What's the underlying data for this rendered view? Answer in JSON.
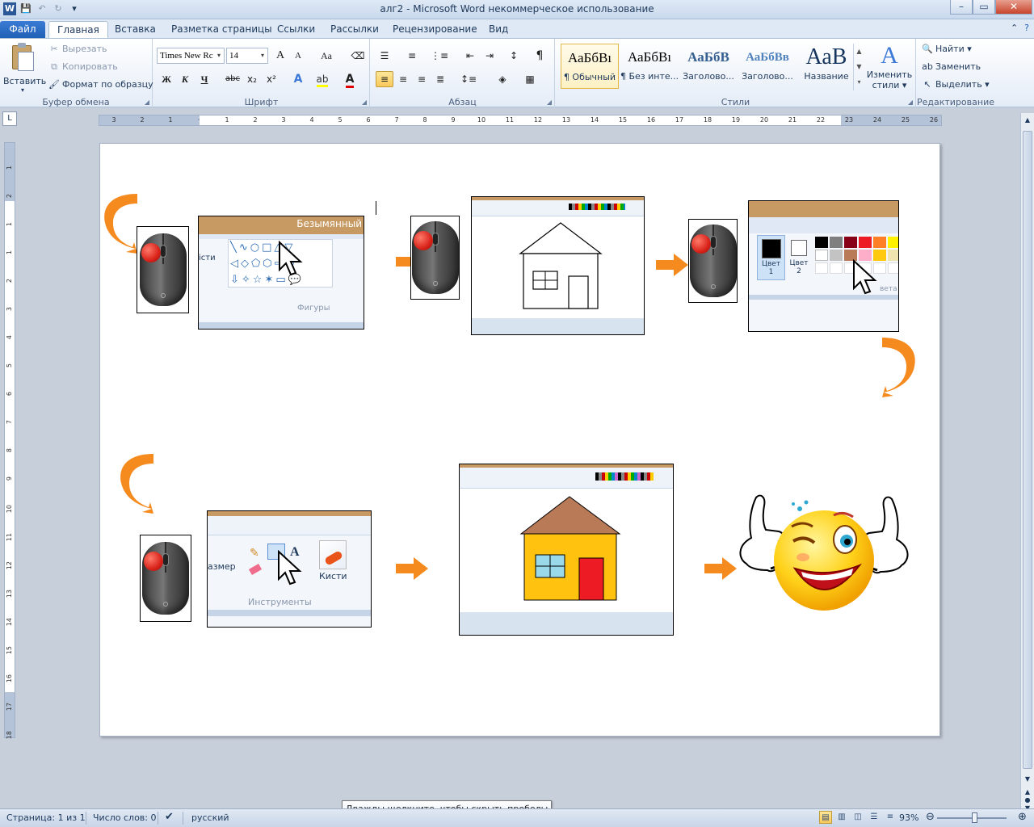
{
  "window": {
    "title": "алг2 - Microsoft Word некоммерческое использование",
    "minimize_glyph": "–",
    "maximize_glyph": "▭",
    "close_glyph": "✕"
  },
  "tabs": {
    "file": "Файл",
    "items": [
      "Главная",
      "Вставка",
      "Разметка страницы",
      "Ссылки",
      "Рассылки",
      "Рецензирование",
      "Вид"
    ],
    "active_index": 0
  },
  "ribbon": {
    "clipboard": {
      "label": "Буфер обмена",
      "paste": "Вставить",
      "cut": "Вырезать",
      "copy": "Копировать",
      "format_painter": "Формат по образцу"
    },
    "font": {
      "label": "Шрифт",
      "font_name": "Times New Rc",
      "font_size": "14",
      "grow": "A",
      "shrink": "A",
      "case": "Aa",
      "bold": "Ж",
      "italic": "К",
      "underline": "Ч",
      "strike": "abc",
      "subscript": "x₂",
      "superscript": "x²"
    },
    "paragraph": {
      "label": "Абзац",
      "pilcrow": "¶"
    },
    "styles": {
      "label": "Стили",
      "items": [
        {
          "sample": "АаБбВı",
          "name": "¶ Обычный"
        },
        {
          "sample": "АаБбВı",
          "name": "¶ Без инте..."
        },
        {
          "sample": "АаБбВ",
          "name": "Заголово..."
        },
        {
          "sample": "АаБбВв",
          "name": "Заголово..."
        },
        {
          "sample": "АаВ",
          "name": "Название"
        }
      ],
      "selected_index": 0,
      "change_styles_line1": "Изменить",
      "change_styles_line2": "стили"
    },
    "editing": {
      "label": "Редактирование",
      "find": "Найти",
      "replace": "Заменить",
      "select": "Выделить"
    }
  },
  "ruler": {
    "h_ticks": [
      "3",
      "2",
      "1",
      "",
      "1",
      "2",
      "3",
      "4",
      "5",
      "6",
      "7",
      "8",
      "9",
      "10",
      "11",
      "12",
      "13",
      "14",
      "15",
      "16",
      "17",
      "18",
      "19",
      "20",
      "21",
      "22",
      "23",
      "24",
      "25",
      "26"
    ],
    "v_ticks": [
      "1",
      "2",
      "1",
      "1",
      "2",
      "3",
      "4",
      "5",
      "6",
      "7",
      "8",
      "9",
      "10",
      "11",
      "12",
      "13",
      "14",
      "15",
      "16",
      "17",
      "18"
    ]
  },
  "document": {
    "frame1": {
      "title": "Безымянный",
      "section": "Фигуры",
      "side": "істи"
    },
    "frame3": {
      "color1": "Цвет",
      "color1_n": "1",
      "color2": "Цвет",
      "color2_n": "2",
      "section": "вета"
    },
    "frame5": {
      "size": "азмер",
      "tools": "Инструменты",
      "brushes": "Кисти"
    }
  },
  "status": {
    "page": "Страница: 1 из 1",
    "words": "Число слов: 0",
    "language": "русский",
    "zoom": "93%",
    "tooltip": "Дважды щелкните, чтобы скрыть пробелы"
  },
  "colors": {
    "accent_orange": "#f58a1f",
    "paint_title": "#c89a63",
    "house_wall": "#ffc20e",
    "house_roof": "#b97a57",
    "door": "#ed1c24",
    "window": "#99d9ea"
  }
}
